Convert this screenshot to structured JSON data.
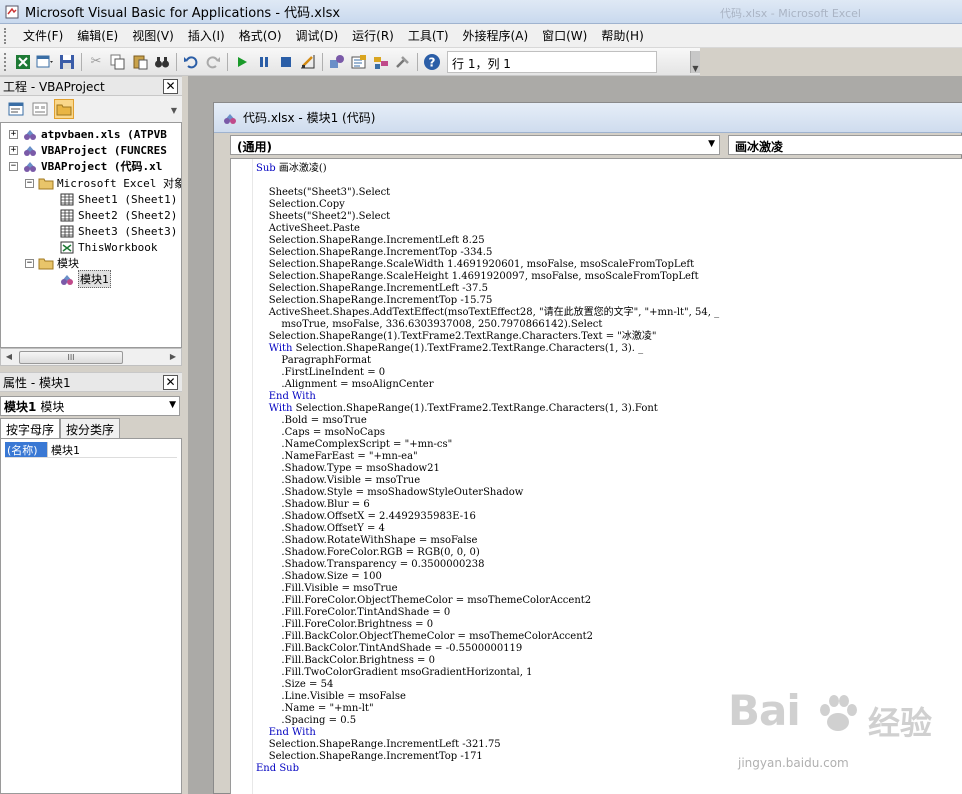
{
  "window": {
    "title": "Microsoft Visual Basic for Applications - 代码.xlsx",
    "background_title": "代码.xlsx - Microsoft Excel"
  },
  "menu": [
    "文件(F)",
    "编辑(E)",
    "视图(V)",
    "插入(I)",
    "格式(O)",
    "调试(D)",
    "运行(R)",
    "工具(T)",
    "外接程序(A)",
    "窗口(W)",
    "帮助(H)"
  ],
  "toolbar": {
    "position": "行 1，列 1"
  },
  "project_pane": {
    "title": "工程 - VBAProject",
    "tree": [
      {
        "label": "atpvbaen.xls (ATPVB",
        "bold": true
      },
      {
        "label": "VBAProject (FUNCRES",
        "bold": true
      },
      {
        "label": "VBAProject (代码.xl",
        "bold": true
      },
      {
        "label": "Microsoft Excel 对象",
        "bold": false
      },
      {
        "label": "Sheet1 (Sheet1)",
        "bold": false
      },
      {
        "label": "Sheet2 (Sheet2)",
        "bold": false
      },
      {
        "label": "Sheet3 (Sheet3)",
        "bold": false
      },
      {
        "label": "ThisWorkbook",
        "bold": false
      },
      {
        "label": "模块",
        "bold": false
      },
      {
        "label": "模块1",
        "bold": false
      }
    ]
  },
  "properties_pane": {
    "title": "属性 - 模块1",
    "object_name": "模块1",
    "object_type": "模块",
    "tabs": [
      "按字母序",
      "按分类序"
    ],
    "rows": [
      {
        "name": "(名称)",
        "value": "模块1"
      }
    ]
  },
  "code_window": {
    "title": "代码.xlsx - 模块1 (代码)",
    "object_dropdown": "(通用)",
    "procedure_dropdown": "画冰激凌",
    "lines": [
      "Sub 画冰激凌()",
      "",
      "    Sheets(\"Sheet3\").Select",
      "    Selection.Copy",
      "    Sheets(\"Sheet2\").Select",
      "    ActiveSheet.Paste",
      "    Selection.ShapeRange.IncrementLeft 8.25",
      "    Selection.ShapeRange.IncrementTop -334.5",
      "    Selection.ShapeRange.ScaleWidth 1.4691920601, msoFalse, msoScaleFromTopLeft",
      "    Selection.ShapeRange.ScaleHeight 1.4691920097, msoFalse, msoScaleFromTopLeft",
      "    Selection.ShapeRange.IncrementLeft -37.5",
      "    Selection.ShapeRange.IncrementTop -15.75",
      "    ActiveSheet.Shapes.AddTextEffect(msoTextEffect28, \"请在此放置您的文字\", \"+mn-lt\", 54, _",
      "        msoTrue, msoFalse, 336.6303937008, 250.7970866142).Select",
      "    Selection.ShapeRange(1).TextFrame2.TextRange.Characters.Text = \"冰激凌\"",
      "    With Selection.ShapeRange(1).TextFrame2.TextRange.Characters(1, 3). _",
      "        ParagraphFormat",
      "        .FirstLineIndent = 0",
      "        .Alignment = msoAlignCenter",
      "    End With",
      "    With Selection.ShapeRange(1).TextFrame2.TextRange.Characters(1, 3).Font",
      "        .Bold = msoTrue",
      "        .Caps = msoNoCaps",
      "        .NameComplexScript = \"+mn-cs\"",
      "        .NameFarEast = \"+mn-ea\"",
      "        .Shadow.Type = msoShadow21",
      "        .Shadow.Visible = msoTrue",
      "        .Shadow.Style = msoShadowStyleOuterShadow",
      "        .Shadow.Blur = 6",
      "        .Shadow.OffsetX = 2.4492935983E-16",
      "        .Shadow.OffsetY = 4",
      "        .Shadow.RotateWithShape = msoFalse",
      "        .Shadow.ForeColor.RGB = RGB(0, 0, 0)",
      "        .Shadow.Transparency = 0.3500000238",
      "        .Shadow.Size = 100",
      "        .Fill.Visible = msoTrue",
      "        .Fill.ForeColor.ObjectThemeColor = msoThemeColorAccent2",
      "        .Fill.ForeColor.TintAndShade = 0",
      "        .Fill.ForeColor.Brightness = 0",
      "        .Fill.BackColor.ObjectThemeColor = msoThemeColorAccent2",
      "        .Fill.BackColor.TintAndShade = -0.5500000119",
      "        .Fill.BackColor.Brightness = 0",
      "        .Fill.TwoColorGradient msoGradientHorizontal, 1",
      "        .Size = 54",
      "        .Line.Visible = msoFalse",
      "        .Name = \"+mn-lt\"",
      "        .Spacing = 0.5",
      "    End With",
      "    Selection.ShapeRange.IncrementLeft -321.75",
      "    Selection.ShapeRange.IncrementTop -171",
      "End Sub"
    ]
  },
  "watermark": {
    "brand": "Bai",
    "brand_cn": "经验",
    "url": "jingyan.baidu.com"
  },
  "colors": {
    "keyword": "#0000c0",
    "selection": "#3978d4",
    "mdi_background": "#abaaa7"
  }
}
